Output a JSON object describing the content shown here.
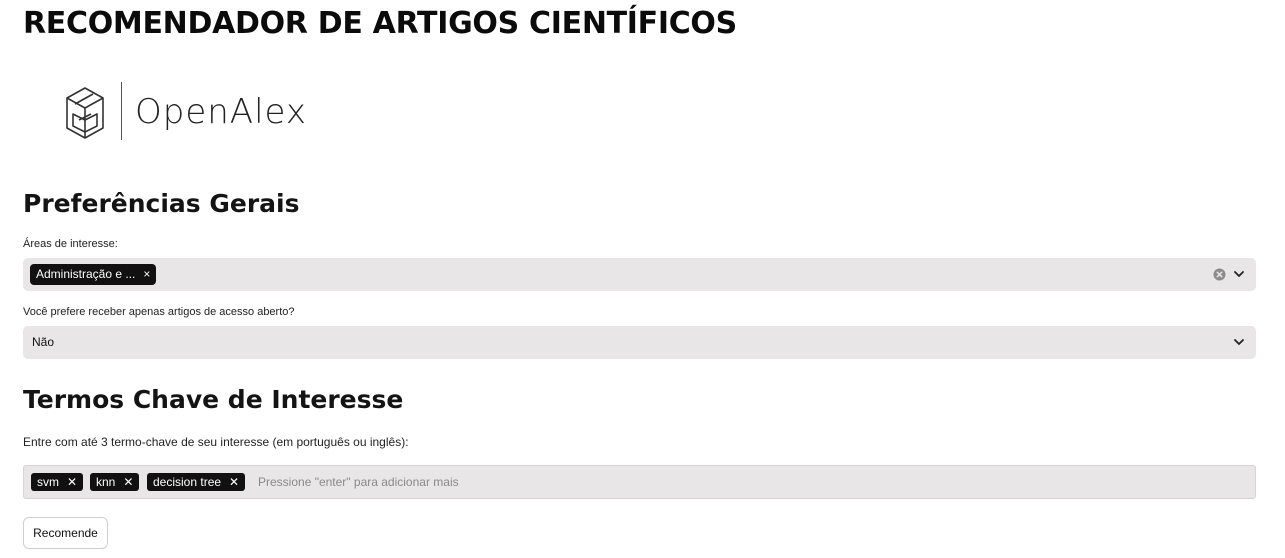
{
  "app": {
    "title": "RECOMENDADOR DE ARTIGOS CIENTÍFICOS",
    "logo_text": "OpenAlex"
  },
  "general": {
    "heading": "Preferências Gerais",
    "areas_label": "Áreas de interesse:",
    "areas_selected": [
      "Administração e ..."
    ],
    "open_access_label": "Você prefere receber apenas artigos de acesso aberto?",
    "open_access_value": "Não"
  },
  "keywords": {
    "heading": "Termos Chave de Interesse",
    "instruction": "Entre com até 3 termo-chave de seu interesse (em português ou inglês):",
    "tags": [
      "svm",
      "knn",
      "decision tree"
    ],
    "placeholder": "Pressione \"enter\" para adicionar mais",
    "remove_symbol": "✕"
  },
  "actions": {
    "recommend_label": "Recomende"
  },
  "icons": {
    "chip_remove": "×",
    "clear": "clear-icon",
    "dropdown": "chevron-down-icon",
    "logo": "openalex-logo-icon"
  },
  "colors": {
    "chip_bg": "#111111",
    "field_bg": "#e8e6e6"
  }
}
